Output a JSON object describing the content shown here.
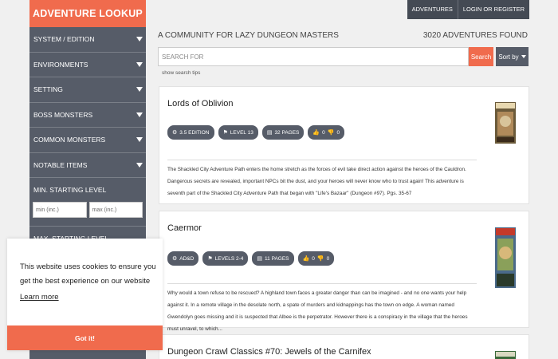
{
  "topnav": {
    "adventures": "Adventures",
    "login": "Login or Register"
  },
  "brand": "ADVENTURE LOOKUP",
  "sidebar": {
    "items": [
      {
        "label": "System / Edition"
      },
      {
        "label": "Environments"
      },
      {
        "label": "Setting"
      },
      {
        "label": "Boss Monsters"
      },
      {
        "label": "Common Monsters"
      },
      {
        "label": "Notable Items"
      }
    ],
    "min_level_label": "Min. Starting Level",
    "min_placeholder": "min (inc.)",
    "max_placeholder": "max (inc.)",
    "max_level_label": "Max. Starting Level"
  },
  "header": {
    "tagline": "A community for lazy dungeon masters",
    "count": "3020 adventures found"
  },
  "search": {
    "placeholder": "SEARCH FOR",
    "button": "Search",
    "sort": "Sort by",
    "tips": "show search tips"
  },
  "cards": [
    {
      "title": "Lords of Oblivion",
      "tags": [
        "3.5 Edition",
        "Level 13",
        "32 Pages",
        "0",
        "0"
      ],
      "description": "The Shackled City Adventure Path enters the home stretch as the forces of evil take direct action against the heroes of the Cauldron. Dangerous secrets are revealed, important NPCs bit the dust, and your heroes will never know who to trust again! This adventure is seventh part of the Shackled City Adventure Path that began with \"Life's Bazaar\" (Dungeon #97). Pgs. 35-67"
    },
    {
      "title": "Caermor",
      "tags": [
        "AD&D",
        "Levels 2-4",
        "11 Pages",
        "0",
        "0"
      ],
      "description": "Why would a town refuse to be rescued? A highland town faces a greater danger than can be imagined - and no one wants your help against it. In a remote village in the desolate north, a spate of murders and kidnappings has the town on edge. A woman named Gwendolyn goes missing and it is suspected that Albee is the perpetrator. However there is a conspiracy in the village that the heroes must unravel, to which..."
    },
    {
      "title": "Dungeon Crawl Classics #70: Jewels of the Carnifex"
    }
  ],
  "cookie": {
    "message": "This website uses cookies to ensure you get the best experience on our website",
    "learn": "Learn more",
    "button": "Got it!"
  },
  "colors": {
    "accent": "#f06b4d",
    "panel": "#565c68"
  }
}
